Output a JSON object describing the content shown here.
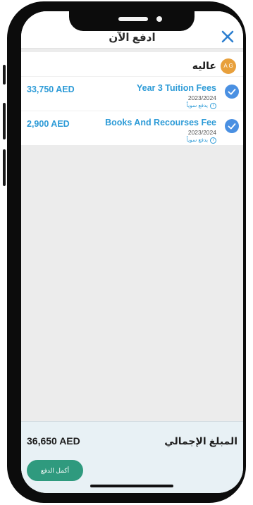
{
  "header": {
    "title": "ادفع الآن",
    "close_icon": "close-icon"
  },
  "student": {
    "name": "عاليه",
    "initials": "A G"
  },
  "fees": [
    {
      "name": "Year 3 Tuition Fees",
      "year": "2023/2024",
      "partial_label": "يدفع سوياً",
      "amount": "33,750 AED",
      "selected": true
    },
    {
      "name": "Books And Recourses Fee",
      "year": "2023/2024",
      "partial_label": "يدفع سوياً",
      "amount": "2,900 AED",
      "selected": true
    }
  ],
  "footer": {
    "total_label": "المبلغ الإجمالي",
    "total_amount": "36,650 AED",
    "pay_button": "أكمل الدفع"
  },
  "colors": {
    "accent": "#2d9bd7",
    "check": "#4a90e2",
    "pay_button": "#2f9a7e",
    "avatar": "#e8a03c"
  }
}
